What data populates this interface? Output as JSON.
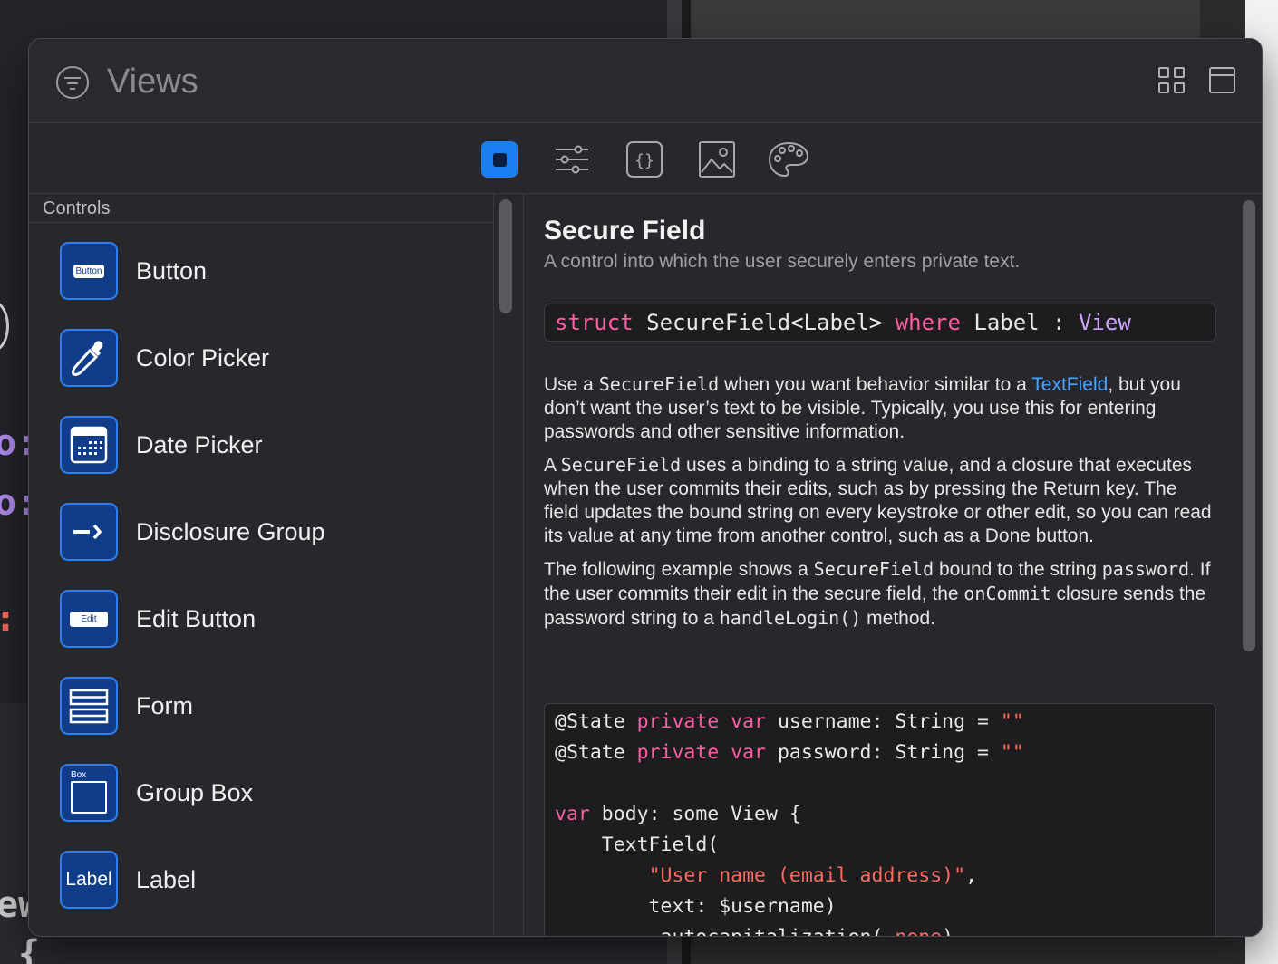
{
  "window": {
    "search_placeholder": "Views"
  },
  "icons": {
    "filter": "filter-circle-icon",
    "grid_view": "grid-view-icon",
    "window": "window-icon",
    "tabs": [
      "views-tab-square-icon",
      "modifiers-sliders-icon",
      "snippets-braces-icon",
      "media-photo-icon",
      "colors-palette-icon"
    ]
  },
  "accent_color": "#1a7ef5",
  "sidebar": {
    "section_title": "Controls",
    "items": [
      {
        "label": "Button",
        "icon": "button-icon",
        "chip": "Button"
      },
      {
        "label": "Color Picker",
        "icon": "eyedropper-icon"
      },
      {
        "label": "Date Picker",
        "icon": "calendar-icon"
      },
      {
        "label": "Disclosure Group",
        "icon": "disclosure-arrow-icon"
      },
      {
        "label": "Edit Button",
        "icon": "edit-button-icon",
        "chip": "Edit"
      },
      {
        "label": "Form",
        "icon": "form-icon"
      },
      {
        "label": "Group Box",
        "icon": "group-box-icon",
        "chip": "Box"
      },
      {
        "label": "Label",
        "icon": "label-icon",
        "chip": "Label"
      }
    ]
  },
  "detail": {
    "title": "Secure Field",
    "subtitle": "A control into which the user securely enters private text.",
    "declaration": {
      "kw1": "struct",
      "name": " SecureField<Label> ",
      "kw2": "where",
      "rest": " Label : ",
      "type": "View"
    },
    "para1": {
      "a": "Use a ",
      "code": "SecureField",
      "b": " when you want behavior similar to a ",
      "link": "TextField",
      "c": ", but you don’t want the user’s text to be visible. Typically, you use this for entering passwords and other sensitive information."
    },
    "para2": {
      "a": "A ",
      "code": "SecureField",
      "b": " uses a binding to a string value, and a closure that executes when the user commits their edits, such as by pressing the Return key. The field updates the bound string on every keystroke or other edit, so you can read its value at any time from another control, such as a Done button."
    },
    "para3": {
      "a": "The following example shows a ",
      "code1": "SecureField",
      "b": " bound to the string ",
      "code2": "password",
      "c": ". If the user commits their edit in the secure field, the ",
      "code3": "onCommit",
      "d": " closure sends the password string to a ",
      "code4": "handleLogin()",
      "e": " method."
    },
    "code_lines": [
      {
        "pre": "@State ",
        "kw": "private var",
        "post": " username: String = ",
        "str": "\"\"",
        "end": ""
      },
      {
        "pre": "@State ",
        "kw": "private var",
        "post": " password: String = ",
        "str": "\"\"",
        "end": ""
      },
      {
        "pre": "",
        "kw": "",
        "post": "",
        "str": "",
        "end": ""
      },
      {
        "pre": "",
        "kw": "var",
        "post": " body: some View {",
        "str": "",
        "end": ""
      },
      {
        "pre": "    TextField(",
        "kw": "",
        "post": "",
        "str": "",
        "end": ""
      },
      {
        "pre": "        ",
        "kw": "",
        "post": "",
        "str": "\"User name (email address)\"",
        "end": ","
      },
      {
        "pre": "        text: $username)",
        "kw": "",
        "post": "",
        "str": "",
        "end": ""
      },
      {
        "pre": "        .autocapitalization(.",
        "kw": "none",
        "post": ")",
        "str": "",
        "end": ""
      }
    ]
  }
}
